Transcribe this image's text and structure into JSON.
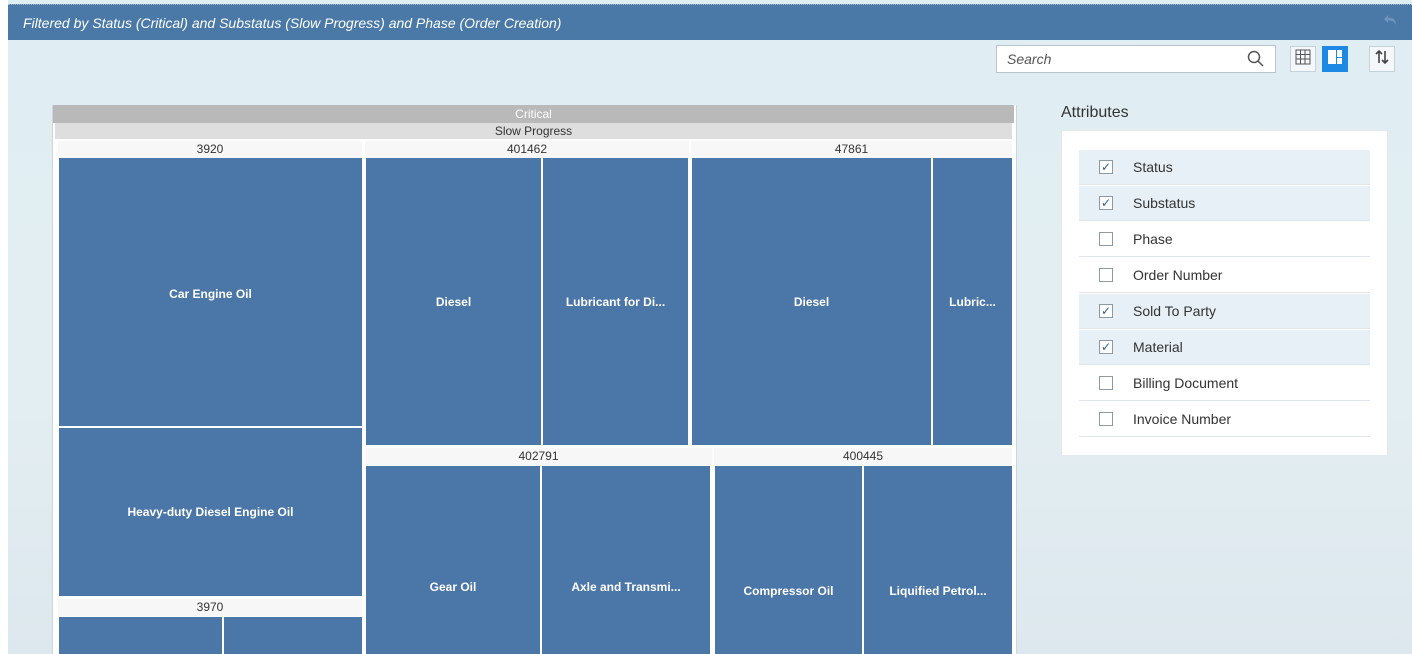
{
  "banner": {
    "text": "Filtered by Status (Critical) and Substatus (Slow Progress) and Phase (Order Creation)"
  },
  "search": {
    "placeholder": "Search"
  },
  "treemap": {
    "status": "Critical",
    "substatus": "Slow Progress",
    "groups": {
      "g3920": "3920",
      "g401462": "401462",
      "g47861": "47861",
      "g402791": "402791",
      "g400445": "400445",
      "g3970": "3970"
    },
    "cells": {
      "car_engine_oil": "Car Engine Oil",
      "heavy_duty": "Heavy-duty Diesel Engine Oil",
      "diesel_a": "Diesel",
      "lubricant_a": "Lubricant for Di...",
      "diesel_b": "Diesel",
      "lubric_b": "Lubric...",
      "gear_oil": "Gear Oil",
      "axle": "Axle and Transmi...",
      "compressor": "Compressor Oil",
      "liquified": "Liquified Petrol..."
    }
  },
  "attributes": {
    "title": "Attributes",
    "items": [
      {
        "label": "Status",
        "checked": true
      },
      {
        "label": "Substatus",
        "checked": true
      },
      {
        "label": "Phase",
        "checked": false
      },
      {
        "label": "Order Number",
        "checked": false
      },
      {
        "label": "Sold To Party",
        "checked": true
      },
      {
        "label": "Material",
        "checked": true
      },
      {
        "label": "Billing Document",
        "checked": false
      },
      {
        "label": "Invoice Number",
        "checked": false
      }
    ]
  },
  "colors": {
    "banner": "#4a79a7",
    "tile": "#4a76a8",
    "accent": "#1e88e5"
  },
  "icons": {
    "undo": "undo-icon",
    "search": "search-icon",
    "table": "table-view-icon",
    "treemap": "treemap-view-icon",
    "sort": "sort-icon"
  }
}
